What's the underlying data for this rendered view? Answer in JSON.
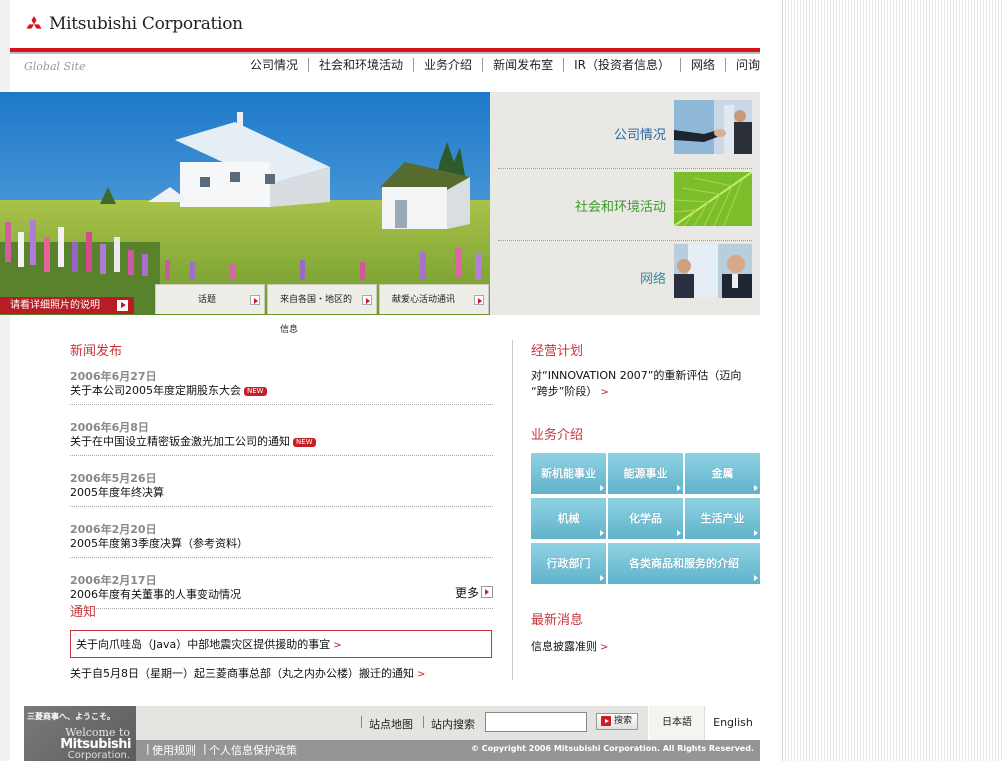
{
  "brand": {
    "name": "Mitsubishi Corporation",
    "global_site": "Global Site",
    "logo_color": "#d5141c"
  },
  "nav": [
    "公司情况",
    "社会和环境活动",
    "业务介绍",
    "新闻发布室",
    "IR（投资者信息）",
    "网络",
    "问询"
  ],
  "hero": {
    "caption": "请看详细照片的说明",
    "tabs": [
      "话题",
      "来自各国・地区的信息",
      "献爱心活动通讯"
    ]
  },
  "features": [
    {
      "label": "公司情况",
      "color": "#2a6aa8"
    },
    {
      "label": "社会和环境活动",
      "color": "#3c9a2c"
    },
    {
      "label": "网络",
      "color": "#2a8fa0"
    }
  ],
  "news": {
    "title": "新闻发布",
    "items": [
      {
        "date": "2006年6月27日",
        "text": "关于本公司2005年度定期股东大会",
        "badge": "NEW"
      },
      {
        "date": "2006年6月8日",
        "text": "关于在中国设立精密钣金激光加工公司的通知",
        "badge": "NEW"
      },
      {
        "date": "2006年5月26日",
        "text": "2005年度年终决算"
      },
      {
        "date": "2006年2月20日",
        "text": "2005年度第3季度决算（参考资料）"
      },
      {
        "date": "2006年2月17日",
        "text": "2006年度有关董事的人事变动情况"
      }
    ],
    "more": "更多"
  },
  "notice": {
    "title": "通知",
    "items": [
      "关于向爪哇岛（Java）中部地震灾区提供援助的事宜",
      "关于自5月8日（星期一）起三菱商事总部（丸之内办公楼）搬迁的通知"
    ]
  },
  "plan": {
    "title": "经营计划",
    "line1": "对“INNOVATION 2007”的重新评估（迈向",
    "line2": "“跨步”阶段）"
  },
  "business": {
    "title": "业务介绍",
    "items": [
      "新机能事业",
      "能源事业",
      "金属",
      "机械",
      "化学品",
      "生活产业",
      "行政部门",
      "各类商品和服务的介绍"
    ]
  },
  "latest": {
    "title": "最新消息",
    "items": [
      "信息披露准则"
    ]
  },
  "footer": {
    "logo_jp": "三菱商事へ、ようこそ。",
    "logo_welcome": "Welcome to",
    "logo_name": "Mitsubishi",
    "logo_corp": "Corporation.",
    "sitemap": "站点地图",
    "site_search": "站内搜索",
    "search_placeholder": "",
    "search_button": "搜索",
    "lang_jp": "日本語",
    "lang_en": "English",
    "terms": "使用规则",
    "privacy": "个人信息保护政策",
    "copyright": "© Copyright 2006 Mitsubishi Corporation. All Rights Reserved."
  }
}
